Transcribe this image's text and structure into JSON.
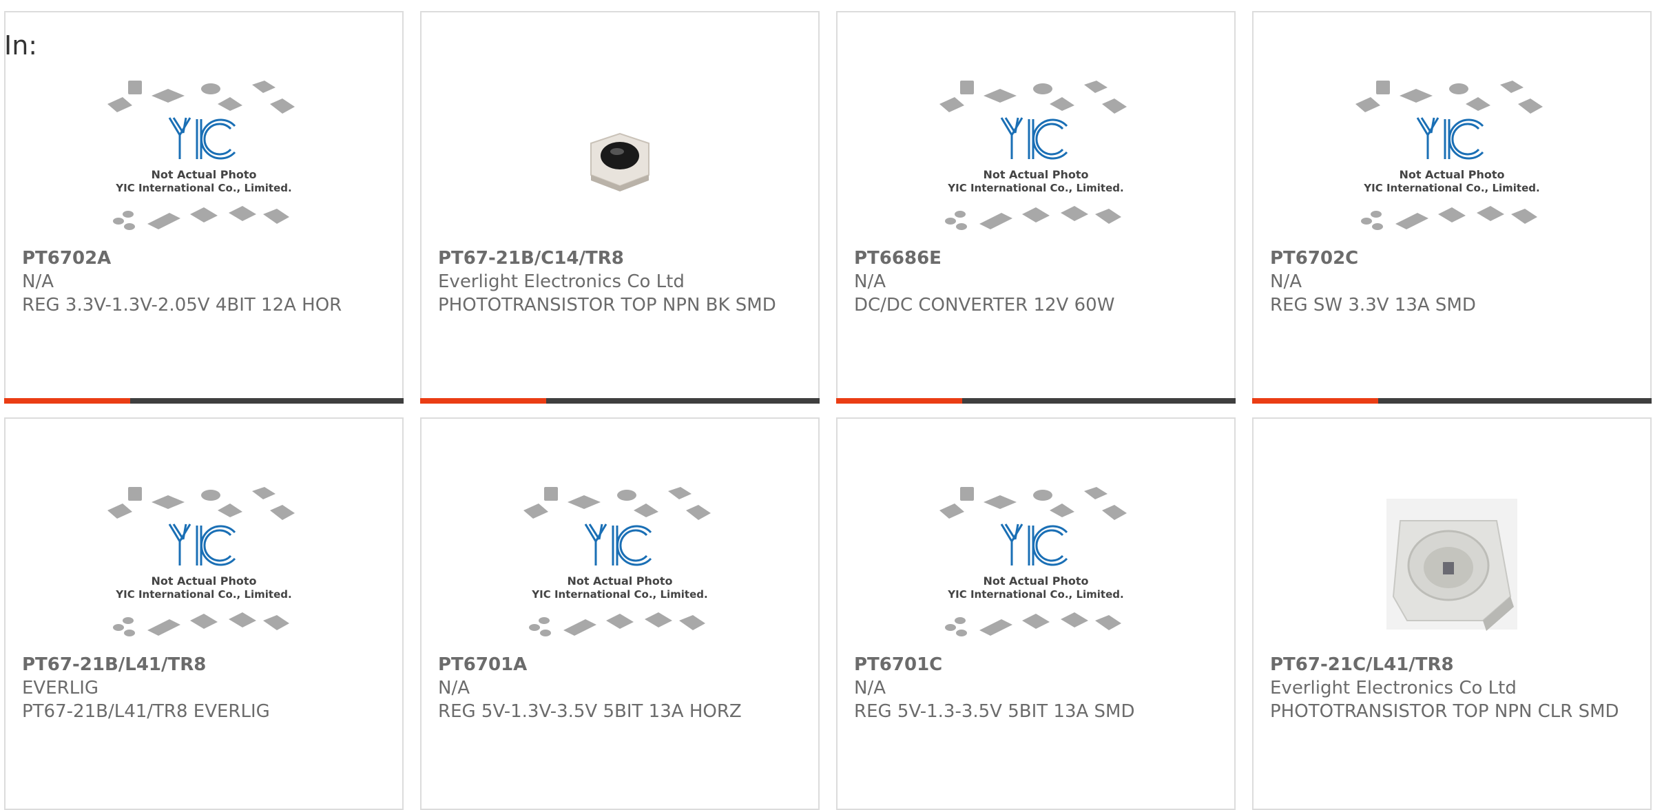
{
  "label": "In:",
  "placeholder": {
    "line1": "Not Actual Photo",
    "line2": "YIC International Co., Limited."
  },
  "colors": {
    "accent": "#ea3d14",
    "bar": "#3f3f3f",
    "logo": "#1a6fb5"
  },
  "products": [
    {
      "pn": "PT6702A",
      "maker": "N/A",
      "desc": "REG 3.3V-1.3V-2.05V 4BIT 12A HOR",
      "image": "placeholder"
    },
    {
      "pn": "PT67-21B/C14/TR8",
      "maker": "Everlight Electronics Co Ltd",
      "desc": "PHOTOTRANSISTOR TOP NPN BK SMD",
      "image": "black-smd-photo"
    },
    {
      "pn": "PT6686E",
      "maker": "N/A",
      "desc": "DC/DC CONVERTER 12V 60W",
      "image": "placeholder"
    },
    {
      "pn": "PT6702C",
      "maker": "N/A",
      "desc": "REG SW 3.3V 13A SMD",
      "image": "placeholder"
    },
    {
      "pn": "PT67-21B/L41/TR8",
      "maker": "EVERLIG",
      "desc": "PT67-21B/L41/TR8 EVERLIG",
      "image": "placeholder"
    },
    {
      "pn": "PT6701A",
      "maker": "N/A",
      "desc": "REG 5V-1.3V-3.5V 5BIT 13A HORZ",
      "image": "placeholder"
    },
    {
      "pn": "PT6701C",
      "maker": "N/A",
      "desc": "REG 5V-1.3-3.5V 5BIT 13A SMD",
      "image": "placeholder"
    },
    {
      "pn": "PT67-21C/L41/TR8",
      "maker": "Everlight Electronics Co Ltd",
      "desc": "PHOTOTRANSISTOR TOP NPN CLR SMD",
      "image": "clear-smd-photo"
    }
  ]
}
